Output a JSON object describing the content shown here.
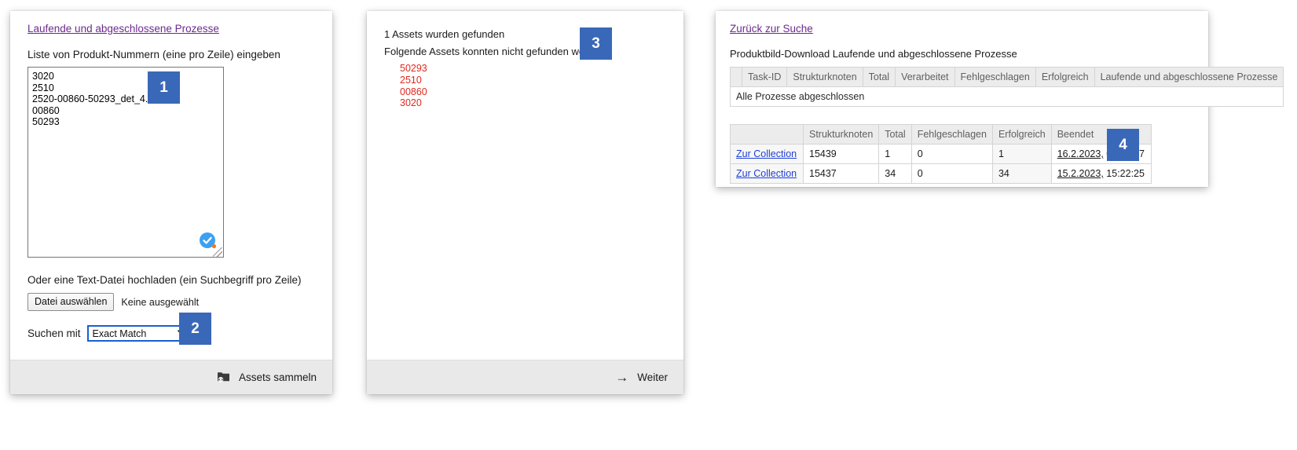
{
  "search_panel": {
    "topic_link": "Laufende und abgeschlossene Prozesse",
    "list_label": "Liste von Produkt-Nummern (eine pro Zeile) eingeben",
    "product_numbers_value": "3020\n2510\n2520-00860-50293_det_4.tif\n00860\n50293",
    "product_numbers_placeholder": "",
    "upload_label": "Oder eine Text-Datei hochladen (ein Suchbegriff pro Zeile)",
    "file_button_label": "Datei auswählen",
    "file_status": "Keine ausgewählt",
    "match_label": "Suchen mit",
    "match_value": "Exact Match",
    "match_options": [
      "Exact Match"
    ],
    "chevron": "⌄",
    "footer_button_label": "Assets sammeln"
  },
  "results_panel": {
    "found_line": "1 Assets wurden gefunden",
    "notfound_line": "Folgende Assets konnten nicht gefunden werden:",
    "not_found": [
      "50293",
      "2510",
      "00860",
      "3020"
    ],
    "footer_button_label": "Weiter",
    "footer_arrow": "→"
  },
  "processes_panel": {
    "back_link": "Zurück zur Suche",
    "title": "Produktbild-Download Laufende und abgeschlossene Prozesse",
    "tasks_table": {
      "headers": [
        "",
        "Task-ID",
        "Strukturknoten",
        "Total",
        "Verarbeitet",
        "Fehlgeschlagen",
        "Erfolgreich",
        "Laufende und abgeschlossene Prozesse"
      ],
      "status_message": "Alle Prozesse abgeschlossen"
    },
    "collections_table": {
      "headers": [
        "",
        "Strukturknoten",
        "Total",
        "Fehlgeschlagen",
        "Erfolgreich",
        "Beendet"
      ],
      "rows": [
        {
          "link": "Zur Collection",
          "strukturknoten": "15439",
          "total": "1",
          "fehlgeschlagen": "0",
          "erfolgreich": "1",
          "beendet_date": "16.2.2023,",
          "beendet_time": "09:17:57"
        },
        {
          "link": "Zur Collection",
          "strukturknoten": "15437",
          "total": "34",
          "fehlgeschlagen": "0",
          "erfolgreich": "34",
          "beendet_date": "15.2.2023,",
          "beendet_time": "15:22:25"
        }
      ]
    }
  },
  "callouts": {
    "one": "1",
    "two": "2",
    "three": "3",
    "four": "4"
  },
  "colors": {
    "callout_blue": "#3a68b8",
    "link_purple": "#6c2a8f",
    "link_blue": "#2040d8",
    "error_red": "#e0281e",
    "focus_border": "#1a5fd0"
  }
}
